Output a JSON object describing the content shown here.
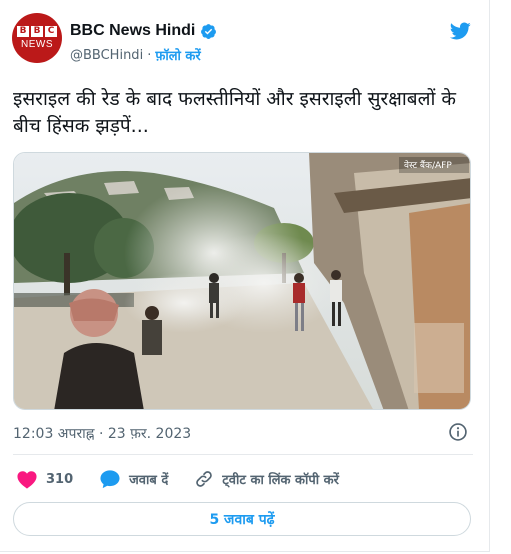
{
  "author": {
    "avatar_top": "BBC",
    "avatar_bottom": "NEWS",
    "display_name": "BBC News Hindi",
    "handle": "@BBCHindi",
    "separator": "·",
    "follow_label": "फ़ॉलो करें"
  },
  "tweet": {
    "text": "इसराइल की रेड के बाद फलस्तीनियों और इसराइली सुरक्षाबलों के बीच हिंसक झड़पें...",
    "media_watermark": "वेस्ट बैंक/AFP",
    "timestamp": "12:03 अपराह्न · 23 फ़र. 2023"
  },
  "actions": {
    "like_count": "310",
    "reply_label": "जवाब दें",
    "copy_link_label": "ट्वीट का लिंक कॉपी करें"
  },
  "replies_button": "5 जवाब पढ़ें",
  "colors": {
    "accent": "#1d9bf0",
    "like": "#f91880",
    "brand_red": "#bb1919"
  },
  "icons": [
    "verified-badge-icon",
    "twitter-bird-icon",
    "info-icon",
    "heart-icon",
    "reply-bubble-icon",
    "link-icon"
  ]
}
